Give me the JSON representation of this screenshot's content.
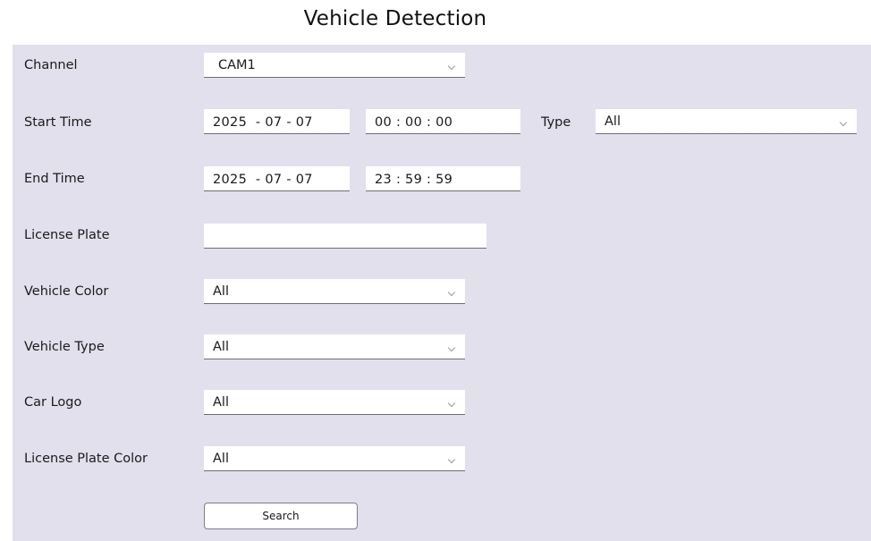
{
  "title": "Vehicle Detection",
  "form": {
    "channel": {
      "label": "Channel",
      "value": "CAM1"
    },
    "start_time": {
      "label": "Start Time",
      "date": "2025  - 07 - 07",
      "time": "00 : 00 : 00"
    },
    "type": {
      "label": "Type",
      "value": "All"
    },
    "end_time": {
      "label": "End Time",
      "date": "2025  - 07 - 07",
      "time": "23 : 59 : 59"
    },
    "license_plate": {
      "label": "License Plate",
      "value": ""
    },
    "vehicle_color": {
      "label": "Vehicle Color",
      "value": "All"
    },
    "vehicle_type": {
      "label": "Vehicle Type",
      "value": "All"
    },
    "car_logo": {
      "label": "Car Logo",
      "value": "All"
    },
    "license_plate_color": {
      "label": "License Plate Color",
      "value": "All"
    },
    "search_label": "Search"
  },
  "icons": {
    "dropdown": "chevron-down-icon"
  },
  "colors": {
    "panel_bg": "#e2e0ec",
    "field_bg": "#ffffff",
    "text": "#1a1a1a"
  }
}
